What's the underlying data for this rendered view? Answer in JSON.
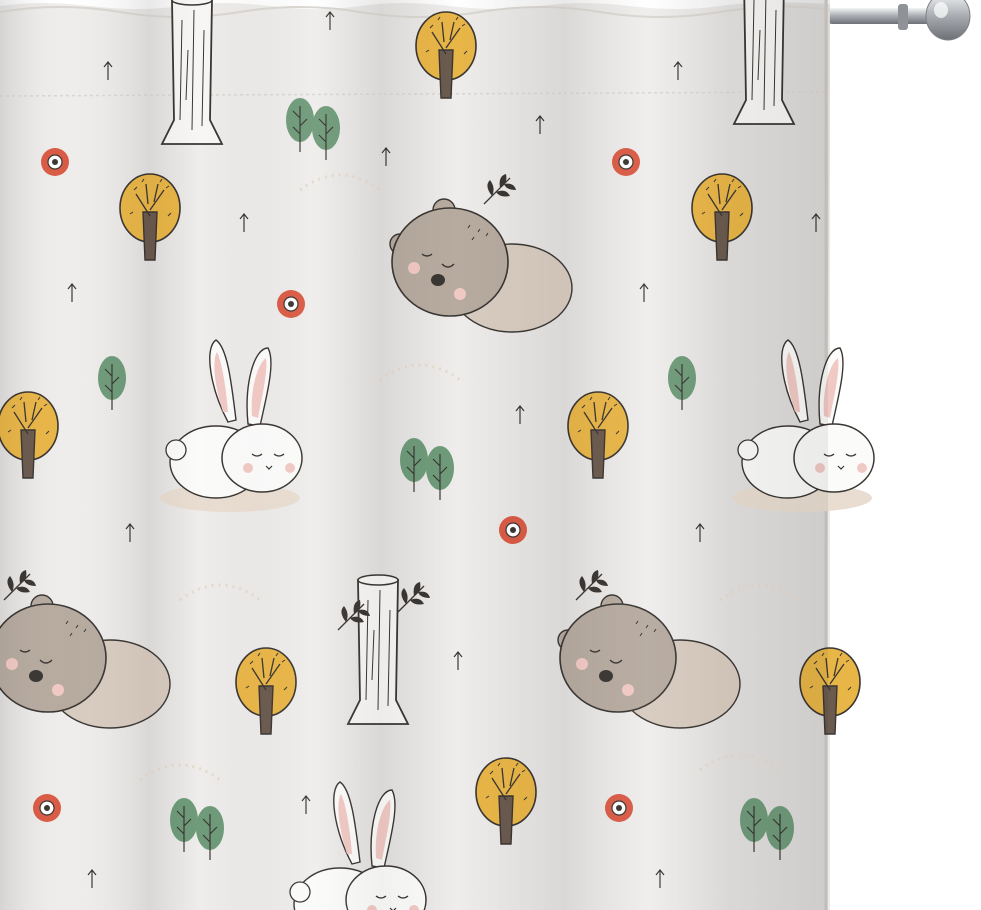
{
  "image": {
    "subject": "product-photo",
    "product": "curtain-panel"
  },
  "palette": {
    "fabric": "#efedeb",
    "fabric_shadow": "#d9d5d0",
    "bear": "#b7aba0",
    "bear_light": "#d8cbc0",
    "bunny": "#fbfbfa",
    "ear_pink": "#f1c9c4",
    "tree_yellow": "#e8b547",
    "tree_green": "#6f9b7a",
    "trunk": "#6b5a4e",
    "flower_red": "#d95b45",
    "line": "#3a3633",
    "rod": "#c9ccd0"
  },
  "motifs": [
    "sleeping-bear",
    "sleeping-bunny",
    "yellow-tree",
    "green-tree-pair",
    "red-flower",
    "tree-stump",
    "arrow-sprig",
    "dashed-path"
  ]
}
